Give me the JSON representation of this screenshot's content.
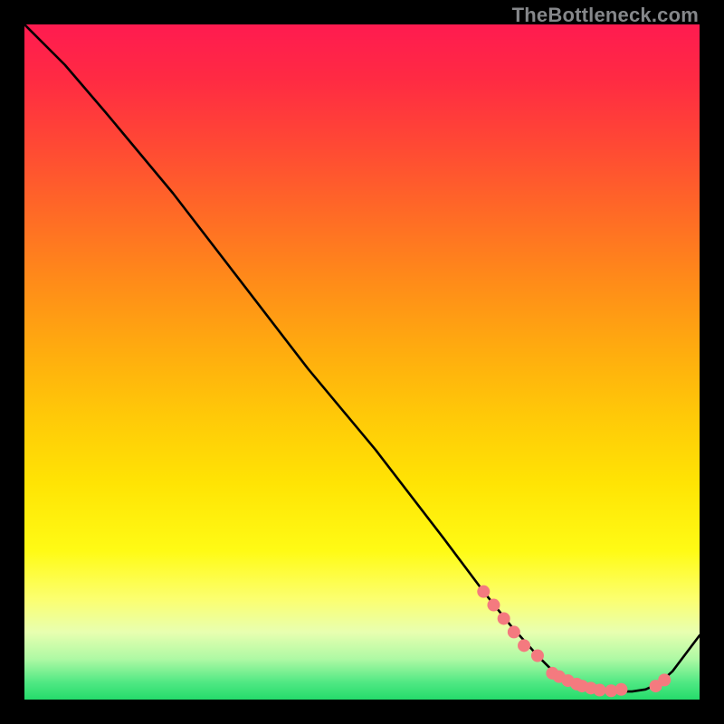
{
  "watermark": "TheBottleneck.com",
  "chart_data": {
    "type": "line",
    "title": "",
    "xlabel": "",
    "ylabel": "",
    "xlim": [
      0,
      100
    ],
    "ylim": [
      0,
      100
    ],
    "grid": false,
    "series": [
      {
        "name": "bottleneck-curve",
        "x": [
          0,
          6,
          12,
          22,
          32,
          42,
          52,
          62,
          68,
          72,
          76,
          78,
          80,
          82,
          84,
          86,
          88,
          90,
          92,
          94,
          96,
          100
        ],
        "y": [
          100,
          94,
          87,
          75,
          62,
          49,
          37,
          24,
          16,
          11,
          6.5,
          4.5,
          3.0,
          2.1,
          1.6,
          1.3,
          1.2,
          1.2,
          1.5,
          2.4,
          4.2,
          9.5
        ]
      }
    ],
    "dots": {
      "name": "highlight-dots",
      "comment": "Discrete salmon markers sitting along the valley of the curve.",
      "points": [
        {
          "x": 68.0,
          "y": 16.0
        },
        {
          "x": 69.5,
          "y": 14.0
        },
        {
          "x": 71.0,
          "y": 12.0
        },
        {
          "x": 72.5,
          "y": 10.0
        },
        {
          "x": 74.0,
          "y": 8.0
        },
        {
          "x": 76.0,
          "y": 6.5
        },
        {
          "x": 78.2,
          "y": 3.9
        },
        {
          "x": 79.2,
          "y": 3.4
        },
        {
          "x": 80.5,
          "y": 2.8
        },
        {
          "x": 81.8,
          "y": 2.3
        },
        {
          "x": 82.6,
          "y": 2.0
        },
        {
          "x": 83.9,
          "y": 1.7
        },
        {
          "x": 85.2,
          "y": 1.4
        },
        {
          "x": 86.9,
          "y": 1.3
        },
        {
          "x": 88.4,
          "y": 1.5
        },
        {
          "x": 93.5,
          "y": 2.0
        },
        {
          "x": 94.8,
          "y": 2.9
        }
      ],
      "color": "#f47a7f",
      "radius": 7
    },
    "line_color": "#000000",
    "line_width": 2.6
  }
}
